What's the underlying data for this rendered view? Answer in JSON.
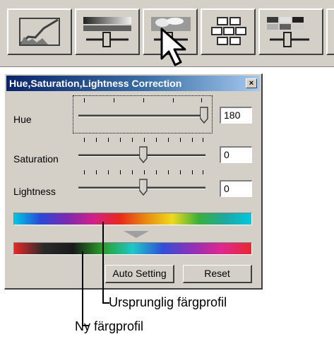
{
  "toolbar": {
    "buttons": [
      {
        "name": "tone-curve",
        "icon": "curve-graph-icon"
      },
      {
        "name": "brightness-contrast",
        "icon": "slider-gradient-icon"
      },
      {
        "name": "hue-saturation",
        "icon": "slider-cloud-icon"
      },
      {
        "name": "variations",
        "icon": "grid-thumbnails-icon"
      },
      {
        "name": "color-balance",
        "icon": "color-slider-icon"
      }
    ]
  },
  "dialog": {
    "title": "Hue,Saturation,Lightness Correction",
    "close_label": "×",
    "hue": {
      "label": "Hue",
      "value": "180"
    },
    "saturation": {
      "label": "Saturation",
      "value": "0"
    },
    "lightness": {
      "label": "Lightness",
      "value": "0"
    },
    "auto_setting_label": "Auto Setting",
    "reset_label": "Reset"
  },
  "annotations": {
    "original": "Ursprunglig färgprofil",
    "new": "Ny färgprofil"
  }
}
